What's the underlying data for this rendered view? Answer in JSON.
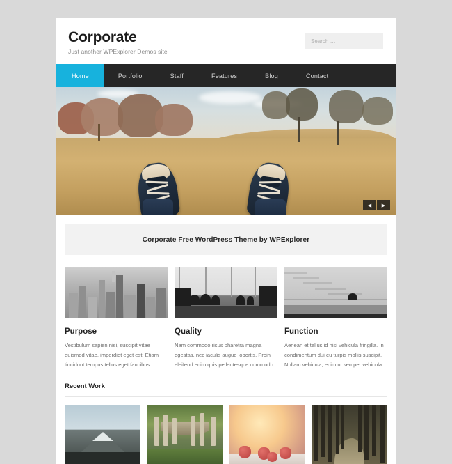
{
  "site": {
    "title": "Corporate",
    "tagline": "Just another WPExplorer Demos site"
  },
  "search": {
    "placeholder": "Search …",
    "value": ""
  },
  "nav": {
    "items": [
      {
        "label": "Home",
        "active": true
      },
      {
        "label": "Portfolio",
        "active": false
      },
      {
        "label": "Staff",
        "active": false
      },
      {
        "label": "Features",
        "active": false
      },
      {
        "label": "Blog",
        "active": false
      },
      {
        "label": "Contact",
        "active": false
      }
    ]
  },
  "slider": {
    "image_alt": "feet-in-sneakers-in-field",
    "prev_label": "◀",
    "next_label": "▶"
  },
  "banner": {
    "text": "Corporate Free WordPress Theme by WPExplorer"
  },
  "features": [
    {
      "title": "Purpose",
      "image_alt": "city-skyline-photo",
      "text": "Vestibulum sapien nisi, suscipit vitae euismod vitae, imperdiet eget est. Etiam tincidunt tempus tellus eget faucibus."
    },
    {
      "title": "Quality",
      "image_alt": "cafe-silhouettes-photo",
      "text": "Nam commodo risus pharetra magna egestas, nec iaculis augue lobortis. Proin eleifend enim quis pellentesque commodo."
    },
    {
      "title": "Function",
      "image_alt": "concrete-stairs-photo",
      "text": "Aenean et tellus id nisi vehicula fringilla. In condimentum dui eu turpis mollis suscipit. Nullam vehicula, enim ut semper vehicula."
    }
  ],
  "recent_work": {
    "title": "Recent Work",
    "thumbs": [
      {
        "image_alt": "snow-mountain-photo"
      },
      {
        "image_alt": "wooden-dock-pier-photo"
      },
      {
        "image_alt": "strawberries-photo"
      },
      {
        "image_alt": "forest-path-photo"
      }
    ]
  },
  "colors": {
    "accent": "#17b2dd",
    "nav_bg": "#262626",
    "page_bg": "#d9d9d9",
    "banner_bg": "#f2f2f2"
  }
}
